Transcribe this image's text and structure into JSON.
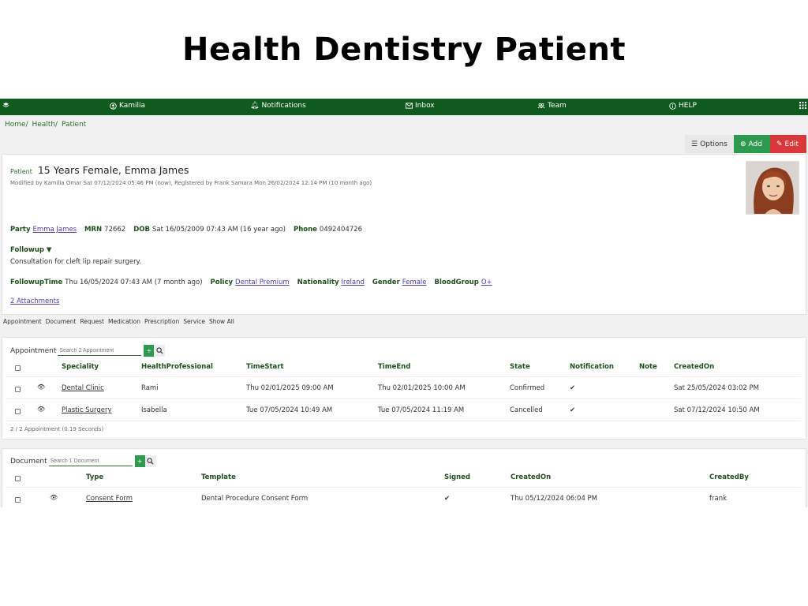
{
  "page_title": "Health Dentistry Patient",
  "topbar": {
    "menu_icon": "layers-icon",
    "user": "Kamilia",
    "notifications": "Notifications",
    "inbox": "Inbox",
    "team": "Team",
    "help": "HELP",
    "apps_icon": "grid-icon",
    "bar_color": "#0f5a1f"
  },
  "breadcrumb": [
    "Home/",
    "Health/",
    "Patient"
  ],
  "toolbar": {
    "options": "Options",
    "add": "Add",
    "edit": "Edit"
  },
  "patient": {
    "label": "Patient",
    "title": "15 Years Female, Emma James",
    "modified": "Modified by Kamilia Omar Sat 07/12/2024 05:46 PM (now), Registered by Frank Samara Mon 26/02/2024 12:14 PM (10 month ago)",
    "party_label": "Party",
    "party": "Emma James",
    "mrn_label": "MRN",
    "mrn": "72662",
    "dob_label": "DOB",
    "dob": "Sat 16/05/2009 07:43 AM (16 year ago)",
    "phone_label": "Phone",
    "phone": "0492404726",
    "followup_label": "Followup ▼",
    "followup_text": "Consultation for cleft lip repair surgery.",
    "followuptime_label": "FollowupTime",
    "followuptime": "Thu 16/05/2024 07:43 AM (7 month ago)",
    "policy_label": "Policy",
    "policy": "Dental Premium",
    "nationality_label": "Nationality",
    "nationality": "Ireland",
    "gender_label": "Gender",
    "gender": "Female",
    "bloodgroup_label": "BloodGroup",
    "bloodgroup": "O+",
    "attachments": "2 Attachments"
  },
  "tabs": [
    "Appointment",
    "Document",
    "Request",
    "Medication",
    "Prescription",
    "Service",
    "Show All"
  ],
  "appointment": {
    "title": "Appointment",
    "search_placeholder": "Search 2 Appointment",
    "columns": [
      "Speciality",
      "HealthProfessional",
      "TimeStart",
      "TimeEnd",
      "State",
      "Notification",
      "Note",
      "CreatedOn"
    ],
    "rows": [
      {
        "speciality": "Dental Clinic",
        "professional": "Rami",
        "start": "Thu 02/01/2025 09:00 AM",
        "end": "Thu 02/01/2025 10:00 AM",
        "state": "Confirmed",
        "notification": "✔",
        "note": "",
        "created": "Sat 25/05/2024 03:02 PM"
      },
      {
        "speciality": "Plastic Surgery",
        "professional": "Isabella",
        "start": "Tue 07/05/2024 10:49 AM",
        "end": "Tue 07/05/2024 11:19 AM",
        "state": "Cancelled",
        "notification": "✔",
        "note": "",
        "created": "Sat 07/12/2024 10:50 AM"
      }
    ],
    "footer": "2 / 2 Appointment (0.19 Seconds)"
  },
  "document": {
    "title": "Document",
    "search_placeholder": "Search 1 Document",
    "columns": [
      "Type",
      "Template",
      "Signed",
      "CreatedOn",
      "CreatedBy"
    ],
    "rows": [
      {
        "type": "Consent Form",
        "template": "Dental Procedure Consent Form",
        "signed": "✔",
        "created": "Thu 05/12/2024 06:04 PM",
        "created_by": "frank"
      }
    ]
  }
}
